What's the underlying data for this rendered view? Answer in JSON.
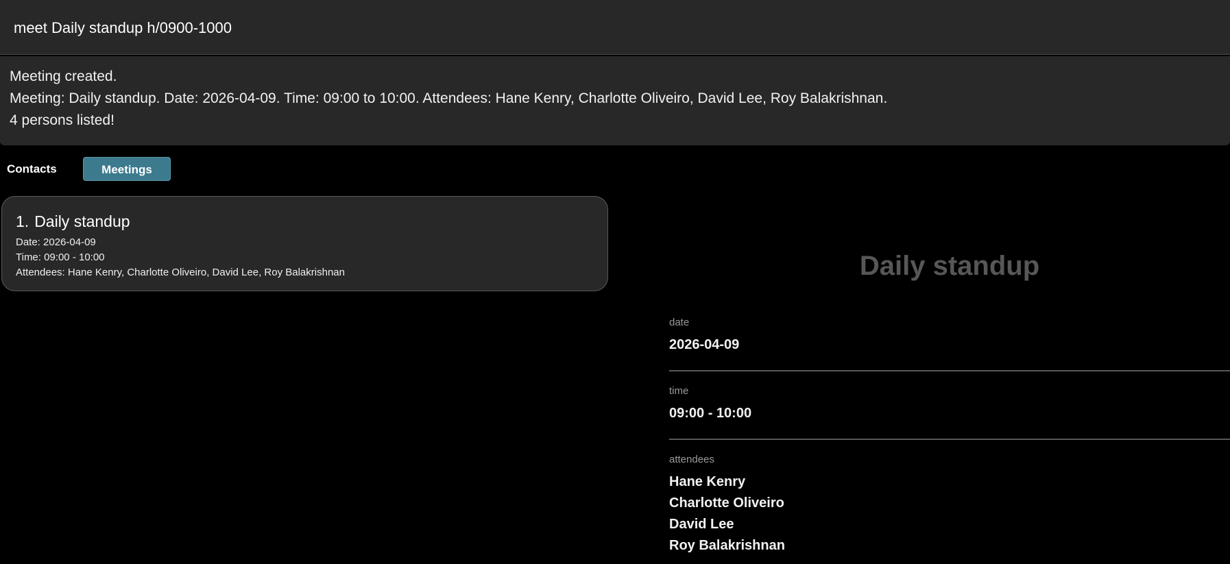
{
  "command": {
    "value": "meet Daily standup h/0900-1000"
  },
  "result": {
    "lines": [
      "Meeting created.",
      "Meeting: Daily standup. Date: 2026-04-09. Time: 09:00 to 10:00. Attendees: Hane Kenry, Charlotte Oliveiro, David Lee, Roy Balakrishnan.",
      "4 persons listed!"
    ]
  },
  "tabs": {
    "contacts": "Contacts",
    "meetings": "Meetings",
    "active": "meetings"
  },
  "meetings": [
    {
      "index": "1.",
      "title": "Daily standup",
      "date_line": "Date: 2026-04-09",
      "time_line": "Time: 09:00 - 10:00",
      "attendees_line": "Attendees: Hane Kenry, Charlotte Oliveiro, David Lee, Roy Balakrishnan"
    }
  ],
  "detail": {
    "title": "Daily standup",
    "date_label": "date",
    "date_value": "2026-04-09",
    "time_label": "time",
    "time_value": "09:00 - 10:00",
    "attendees_label": "attendees",
    "attendees": [
      "Hane Kenry",
      "Charlotte Oliveiro",
      "David Lee",
      "Roy Balakrishnan"
    ]
  },
  "colors": {
    "background": "#000000",
    "panel": "#282828",
    "accent": "#3c7a8e",
    "detail_title": "#575757",
    "label": "#9a9a9a"
  }
}
